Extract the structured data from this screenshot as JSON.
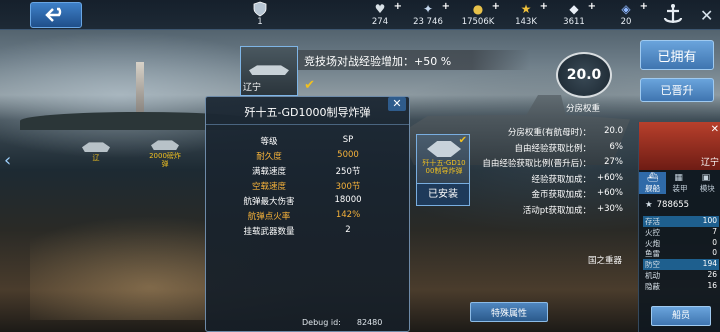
{
  "topbar": {
    "level": "1",
    "resources": [
      {
        "icon": "heart-icon",
        "value": "274"
      },
      {
        "icon": "medal-icon",
        "value": "23 746"
      },
      {
        "icon": "gold-coins-icon",
        "value": "17506K"
      },
      {
        "icon": "star-icon",
        "value": "143K"
      },
      {
        "icon": "diamond-icon",
        "value": "3611"
      },
      {
        "icon": "crystal-icon",
        "value": "20"
      }
    ]
  },
  "banner": {
    "text": "竞技场对战经验增加：+50 %"
  },
  "selected_ship": {
    "name": "辽宁"
  },
  "sp": {
    "value": "20.0",
    "label": "分房权重"
  },
  "buttons": {
    "owned": "已拥有",
    "promoted": "已晋升",
    "installed": "已安装",
    "special": "特殊属性",
    "ship": "船员"
  },
  "markers": [
    {
      "label": "辽"
    },
    {
      "label": "2000磅炸\n弹"
    },
    {
      "label": "歼十五-GD1000制导炸弹"
    }
  ],
  "popup": {
    "title": "歼十五-GD1000制导炸弹",
    "close": "✕",
    "stats": [
      {
        "label": "等级",
        "value": "SP",
        "highlight": false
      },
      {
        "label": "耐久度",
        "value": "5000",
        "highlight": true
      },
      {
        "label": "满载速度",
        "value": "250节",
        "highlight": false
      },
      {
        "label": "空载速度",
        "value": "300节",
        "highlight": true
      },
      {
        "label": "航弹最大伤害",
        "value": "18000",
        "highlight": false
      },
      {
        "label": "航弹点火率",
        "value": "142%",
        "highlight": true
      },
      {
        "label": "挂载武器数量",
        "value": "2",
        "highlight": false
      }
    ],
    "debug_label": "Debug id:",
    "debug_value": "82480"
  },
  "weapon_card": {
    "name": "歼十五-GD10\n00制导炸弹"
  },
  "bonuses": [
    {
      "label": "分房权重(有航母时)：",
      "value": "20.0"
    },
    {
      "label": "自由经验获取比例：",
      "value": "6%"
    },
    {
      "label": "自由经验获取比例(晋升后)：",
      "value": "27%"
    },
    {
      "label": "经验获取加成：",
      "value": "+60%"
    },
    {
      "label": "金币获取加成：",
      "value": "+60%"
    },
    {
      "label": "活动pt获取加成：",
      "value": "+30%"
    }
  ],
  "kingdom": "国之重器",
  "right_panel": {
    "ship_name": "辽宁",
    "tabs": [
      "舰船",
      "装甲",
      "模块"
    ],
    "rating": "788655",
    "attributes": [
      {
        "name": "存活",
        "value": "100",
        "highlight": true
      },
      {
        "name": "火控",
        "value": "7",
        "highlight": false
      },
      {
        "name": "火炮",
        "value": "0",
        "highlight": false
      },
      {
        "name": "鱼雷",
        "value": "0",
        "highlight": false
      },
      {
        "name": "防空",
        "value": "194",
        "highlight": true
      },
      {
        "name": "机动",
        "value": "26",
        "highlight": false
      },
      {
        "name": "隐蔽",
        "value": "16",
        "highlight": false
      }
    ]
  }
}
